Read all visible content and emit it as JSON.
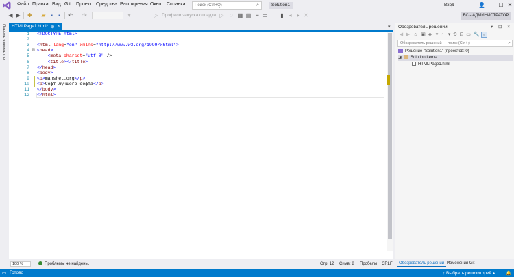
{
  "menu": {
    "items": [
      "Файл",
      "Правка",
      "Вид",
      "Git",
      "Проект",
      "Средства",
      "Расширения",
      "Окно",
      "Справка"
    ]
  },
  "search": {
    "placeholder": "Поиск (Ctrl+Q)"
  },
  "solution_badge": "Solution1",
  "login": "Вход",
  "toolbar": {
    "profiles_label": "Профили запуска отладки",
    "admin_label": "ВС - АДМИНИСТРАТОР"
  },
  "left_panel": {
    "label": "Панель элементов"
  },
  "editor": {
    "tab_title": "HTMLPage1.html*",
    "tab_pin": "⊕",
    "tab_close": "×",
    "lines": [
      {
        "n": "1",
        "fold": "",
        "text": "<!DOCTYPE html>"
      },
      {
        "n": "2",
        "fold": "",
        "text": ""
      },
      {
        "n": "3",
        "fold": "",
        "text": "<html lang=\"en\" xmlns=\"http://www.w3.org/1999/xhtml\">"
      },
      {
        "n": "4",
        "fold": "⊟",
        "text": "<head>"
      },
      {
        "n": "5",
        "fold": "",
        "text": "    <meta charset=\"utf-8\" />"
      },
      {
        "n": "6",
        "fold": "",
        "text": "    <title></title>"
      },
      {
        "n": "7",
        "fold": "",
        "text": "</head>"
      },
      {
        "n": "8",
        "fold": "",
        "text": "<body>"
      },
      {
        "n": "9",
        "fold": "",
        "text": "<p>manshet.org</p>"
      },
      {
        "n": "10",
        "fold": "",
        "text": "<p>Софт лучшего софта</p>"
      },
      {
        "n": "11",
        "fold": "",
        "text": "</body>"
      },
      {
        "n": "12",
        "fold": "",
        "text": "</html>"
      }
    ],
    "changed_lines": [
      "9",
      "10"
    ]
  },
  "editor_status": {
    "zoom": "100 %",
    "problems": "Проблемы не найдены.",
    "line": "Стр: 12",
    "col": "Симв: 8",
    "spaces": "Пробелы",
    "eol": "CRLF"
  },
  "solution_explorer": {
    "title": "Обозреватель решений",
    "header_controls": "▾ ⊡ ×",
    "search_placeholder": "Обозреватель решений — поиск (Ctrl+;)",
    "solution_node": "Решение \"Solution1\" (проектов: 0)",
    "folder_node": "Solution Items",
    "file_node": "HTMLPage1.html",
    "tabs": [
      "Обозреватель решений",
      "Изменения Git"
    ]
  },
  "statusbar": {
    "ready": "Готово",
    "repo": "↑ Выбрать репозиторий ▴"
  },
  "colors": {
    "accent": "#007acc",
    "tag": "#800000",
    "attr": "#ff0000",
    "value": "#0000ff"
  }
}
